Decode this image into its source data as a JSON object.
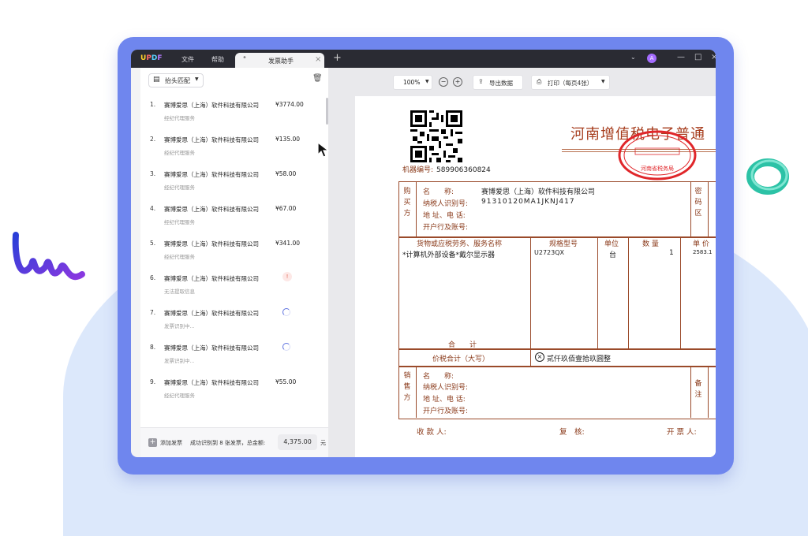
{
  "colors": {
    "frame": "#6f86ee",
    "titlebar": "#2a2b33",
    "accent": "#5b6fdf",
    "invoice_ink": "#8a3a1a",
    "seal": "#e0262a"
  },
  "app": {
    "logo": "UPDF",
    "menu": [
      "文件",
      "帮助"
    ],
    "tab": {
      "dot": "•",
      "label": "发票助手",
      "close": "×"
    },
    "new_tab": "+",
    "avatar": "A",
    "window_controls": [
      "—",
      "□",
      "×"
    ]
  },
  "left_panel": {
    "sort_button": "抬头匹配",
    "invoices": [
      {
        "num": "1.",
        "company": "赛博爱思（上海）软件科技有限公司",
        "service": "经纪代理服务",
        "amount": "¥3774.00",
        "status": "done"
      },
      {
        "num": "2.",
        "company": "赛博爱思（上海）软件科技有限公司",
        "service": "经纪代理服务",
        "amount": "¥135.00",
        "status": "done"
      },
      {
        "num": "3.",
        "company": "赛博爱思（上海）软件科技有限公司",
        "service": "经纪代理服务",
        "amount": "¥58.00",
        "status": "done"
      },
      {
        "num": "4.",
        "company": "赛博爱思（上海）软件科技有限公司",
        "service": "经纪代理服务",
        "amount": "¥67.00",
        "status": "done"
      },
      {
        "num": "5.",
        "company": "赛博爱思（上海）软件科技有限公司",
        "service": "经纪代理服务",
        "amount": "¥341.00",
        "status": "done"
      },
      {
        "num": "6.",
        "company": "赛博爱思（上海）软件科技有限公司",
        "service": "无法提取信息",
        "amount": "",
        "status": "error"
      },
      {
        "num": "7.",
        "company": "赛博爱思（上海）软件科技有限公司",
        "service": "发票识别中...",
        "amount": "",
        "status": "loading"
      },
      {
        "num": "8.",
        "company": "赛博爱思（上海）软件科技有限公司",
        "service": "发票识别中...",
        "amount": "",
        "status": "loading"
      },
      {
        "num": "9.",
        "company": "赛博爱思（上海）软件科技有限公司",
        "service": "经纪代理服务",
        "amount": "¥55.00",
        "status": "done"
      }
    ],
    "footer": {
      "add_label": "添加发票",
      "summary": "成功识别到 8 张发票，总金额:",
      "total": "4,375.00",
      "unit": "元"
    }
  },
  "toolbar": {
    "zoom": "100%",
    "export": "导出数据",
    "print": "打印（每页4张）"
  },
  "invoice": {
    "title": "河南增值税电子普通",
    "machine_label": "机器编号:",
    "machine_no": "589906360824",
    "buyer_label": "购买方",
    "buyer": {
      "name_label": "名　　称:",
      "name": "赛博爱思（上海）软件科技有限公司",
      "tax_label": "纳税人识别号:",
      "tax_id": "91310120MA1JKNJ417",
      "addr_label": "地 址、电 话:",
      "bank_label": "开户行及账号:"
    },
    "secret_label": "密码区",
    "columns": [
      "货物或应税劳务、服务名称",
      "规格型号",
      "单位",
      "数 量",
      "单 价"
    ],
    "item": {
      "name": "*计算机外部设备*戴尔显示器",
      "model": "U2723QX",
      "unit": "台",
      "qty": "1",
      "price": "2583.1"
    },
    "subtotal_label": "合　　计",
    "total_label": "价税合计（大写）",
    "total_words": "贰仟玖佰壹拾玖圆整",
    "seller_label": "销售方",
    "seller": {
      "name_label": "名　　称:",
      "tax_label": "纳税人识别号:",
      "addr_label": "地 址、电 话:",
      "bank_label": "开户行及账号:"
    },
    "remark_label": "备注",
    "payee_label": "收 款 人:",
    "reviewer_label": "复　核:",
    "drawer_label": "开 票 人:",
    "seal_text": "河南省税务局"
  }
}
